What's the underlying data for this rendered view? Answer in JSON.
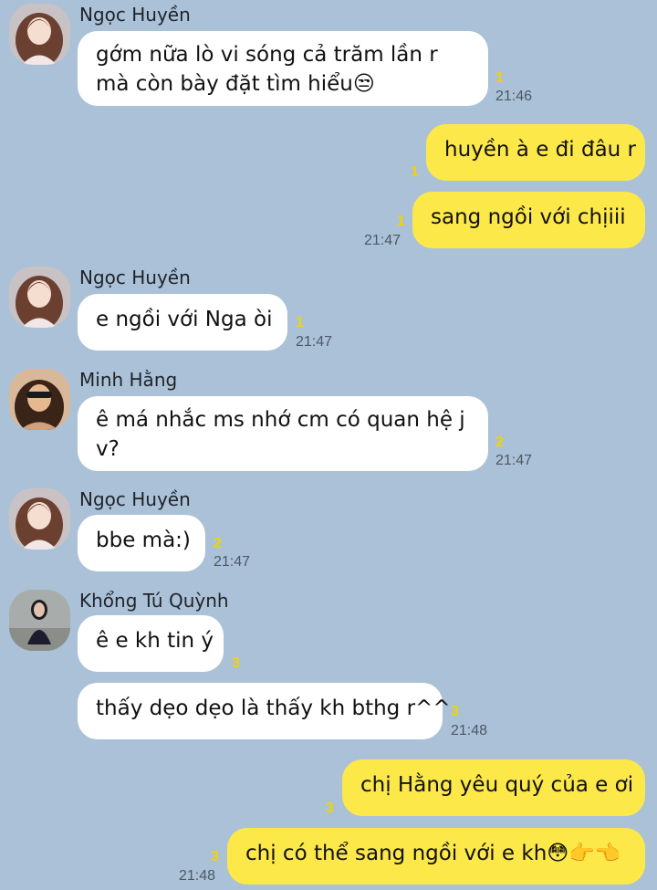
{
  "messages": [
    {
      "sender": "Ngọc Huyền",
      "lines": [
        "gớm nữa lò vi sóng cả trăm lần r",
        "mà còn bày đặt tìm hiểu😒"
      ],
      "unread": "1",
      "time": "21:46"
    },
    {
      "text": "huyền à e đi đâu r",
      "unread": "1"
    },
    {
      "text": "sang ngồi với chịiii",
      "unread": "1",
      "time": "21:47"
    },
    {
      "sender": "Ngọc Huyền",
      "text": "e ngồi với Nga òi",
      "unread": "1",
      "time": "21:47"
    },
    {
      "sender": "Minh Hằng",
      "lines": [
        "ê má nhắc ms nhớ cm có quan hệ j",
        "v?"
      ],
      "unread": "2",
      "time": "21:47"
    },
    {
      "sender": "Ngọc Huyền",
      "text": "bbe mà:)",
      "unread": "2",
      "time": "21:47"
    },
    {
      "sender": "Khổng Tú Quỳnh",
      "text": "ê e kh tin ý",
      "unread": "3"
    },
    {
      "text": "thấy dẹo dẹo là thấy kh bthg r^^",
      "unread": "3",
      "time": "21:48"
    },
    {
      "text": "chị Hằng yêu quý của e ơi",
      "unread": "3"
    },
    {
      "text": "chị có thể sang ngồi với e kh😳👉👈",
      "unread": "3",
      "time": "21:48"
    }
  ],
  "colors": {
    "background": "#abc1d7",
    "incoming": "#ffffff",
    "outgoing": "#fde84a",
    "unread": "#f2d300"
  }
}
